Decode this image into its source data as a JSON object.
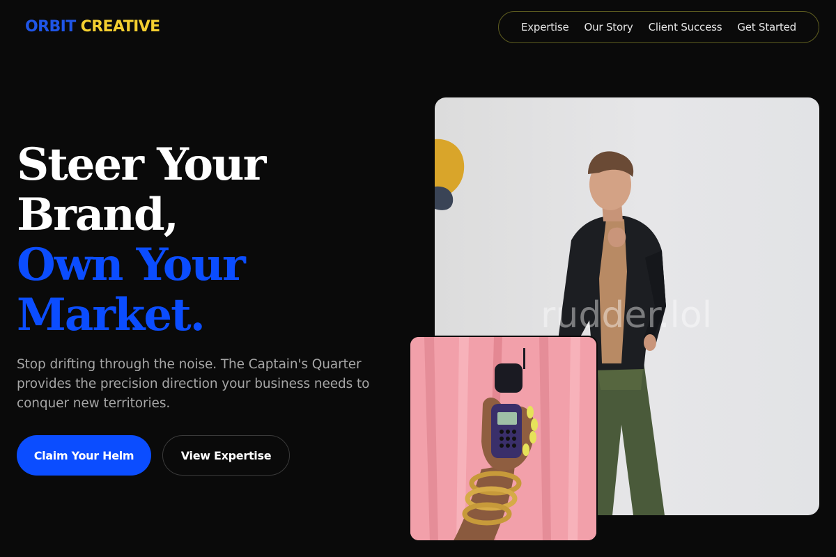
{
  "brand": {
    "word1": "ORBIT",
    "word2": "CREATIVE"
  },
  "nav": [
    {
      "label": "Expertise"
    },
    {
      "label": "Our Story"
    },
    {
      "label": "Client Success"
    },
    {
      "label": "Get Started"
    }
  ],
  "hero": {
    "headline_lines": [
      "Steer Your",
      "Brand,"
    ],
    "headline_accent_lines": [
      "Own Your",
      "Market."
    ],
    "subtext": "Stop drifting through the noise. The Captain's Quarter provides the precision direction your business needs to conquer new territories.",
    "primary_cta": "Claim Your Helm",
    "secondary_cta": "View Expertise"
  },
  "images": {
    "main_watermark": "rudder.lol"
  },
  "colors": {
    "background": "#0a0a0a",
    "accent_blue": "#0b4dff",
    "accent_yellow": "#f4cf30",
    "nav_border": "#5b5a1f"
  }
}
